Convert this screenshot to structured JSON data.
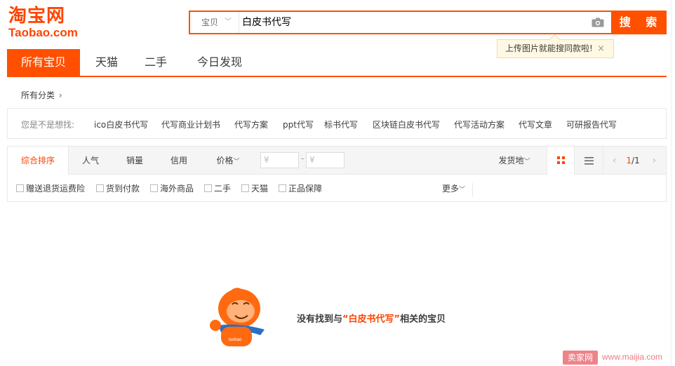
{
  "logo": {
    "cn": "淘宝网",
    "en": "Taobao.com"
  },
  "search": {
    "category": "宝贝",
    "query": "白皮书代写",
    "button": "搜 索",
    "tip": "上传图片就能搜同款啦!",
    "tip_close": "×"
  },
  "tabs": [
    "所有宝贝",
    "天猫",
    "二手",
    "今日发现"
  ],
  "breadcrumb": "所有分类",
  "suggest": {
    "label": "您是不是想找:",
    "items": [
      "ico白皮书代写",
      "代写商业计划书",
      "代写方案",
      "ppt代写",
      "标书代写",
      "区块链白皮书代写",
      "代写活动方案",
      "代写文章",
      "可研报告代写"
    ]
  },
  "sort": {
    "items": [
      "综合排序",
      "人气",
      "销量",
      "信用",
      "价格"
    ],
    "price_min_placeholder": "¥",
    "price_max_placeholder": "¥",
    "price_dash": "-",
    "ship_from": "发货地",
    "page": "1",
    "pages": "/1"
  },
  "checkboxes": [
    "赠送退货运费险",
    "货到付款",
    "海外商品",
    "二手",
    "天猫",
    "正品保障"
  ],
  "more": "更多",
  "empty": {
    "prefix": "没有找到与",
    "keyword": "“白皮书代写”",
    "suffix": "相关的宝贝"
  },
  "mascot_text": "taobao",
  "watermark": {
    "badge": "卖家网",
    "url": "www.maijia.com"
  },
  "colors": {
    "brand": "#ff5000",
    "accent_text": "#ff4400"
  }
}
